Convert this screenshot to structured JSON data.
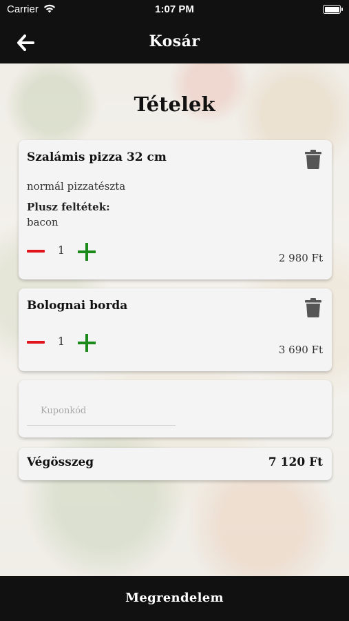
{
  "status_bar": {
    "carrier": "Carrier",
    "time": "1:07 PM"
  },
  "nav": {
    "title": "Kosár"
  },
  "section_title": "Tételek",
  "cart_items": [
    {
      "name": "Szalámis pizza 32 cm",
      "dough": "normál pizzatészta",
      "extras_label": "Plusz feltétek:",
      "extras": "bacon",
      "quantity": "1",
      "price": "2 980 Ft"
    },
    {
      "name": "Bolognai borda",
      "quantity": "1",
      "price": "3 690 Ft"
    }
  ],
  "coupon": {
    "placeholder": "Kuponkód",
    "value": ""
  },
  "total": {
    "label": "Végösszeg",
    "value": "7 120 Ft"
  },
  "order_button": {
    "label": "Megrendelem"
  },
  "colors": {
    "bar": "#111111",
    "minus": "#e0121a",
    "plus": "#1b8a1b",
    "card": "#f4f4f4"
  }
}
